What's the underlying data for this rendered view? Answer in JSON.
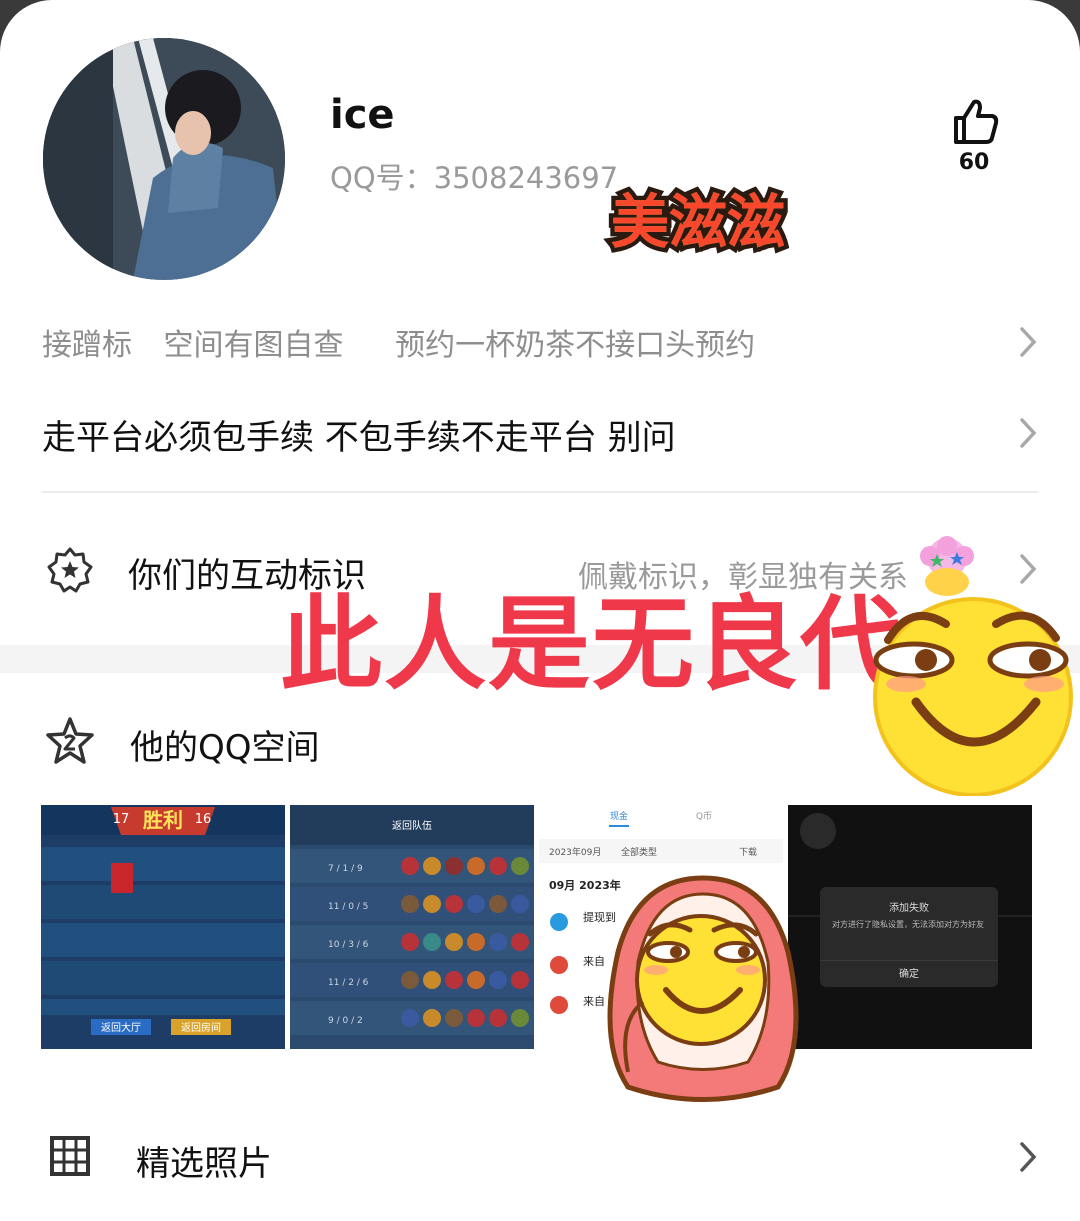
{
  "profile": {
    "name": "ice",
    "qq_label": "QQ号：",
    "qq_number": "3508243697",
    "likes": "60"
  },
  "stickers": {
    "meizizi": "美滋滋",
    "overlay": "此人是无良代"
  },
  "tags": [
    "接蹭标",
    "空间有图自查",
    "预约一杯奶茶不接口头预约"
  ],
  "signature": "走平台必须包手续 不包手续不走平台 别问",
  "interaction": {
    "label": "你们的互动标识",
    "hint": "佩戴标识，彰显独有关系"
  },
  "qzone": {
    "label": "他的QQ空间",
    "thumbs": {
      "t1": {
        "left_score": "17",
        "result": "胜利",
        "right_score": "16",
        "btn1": "返回大厅",
        "btn2": "返回房间"
      },
      "t2": {
        "header": "返回队伍",
        "rows": [
          "7 / 1 / 9",
          "11 / 0 / 5",
          "10 / 3 / 6",
          "11 / 2 / 6",
          "9 / 0 / 2"
        ]
      },
      "t3": {
        "tab1": "现金",
        "tab2": "Q币",
        "month": "2023年09月",
        "filter": "全部类型",
        "download": "下载",
        "section": "09月 2023年",
        "item1": "提现到",
        "item2": "来自",
        "item3": "来自"
      },
      "t4": {
        "dialog_title": "添加失败",
        "dialog_body": "对方进行了隐私设置，无法添加对方为好友",
        "dialog_btn": "确定"
      }
    }
  },
  "photos": {
    "label": "精选照片"
  },
  "icons": [
    "thumbs-up-icon",
    "badge-star-icon",
    "star-icon",
    "grid-icon",
    "chevron-right-icon"
  ],
  "colors": {
    "overlay_red": "#f0384b",
    "muted": "#9a9a9a",
    "text": "#111111"
  }
}
